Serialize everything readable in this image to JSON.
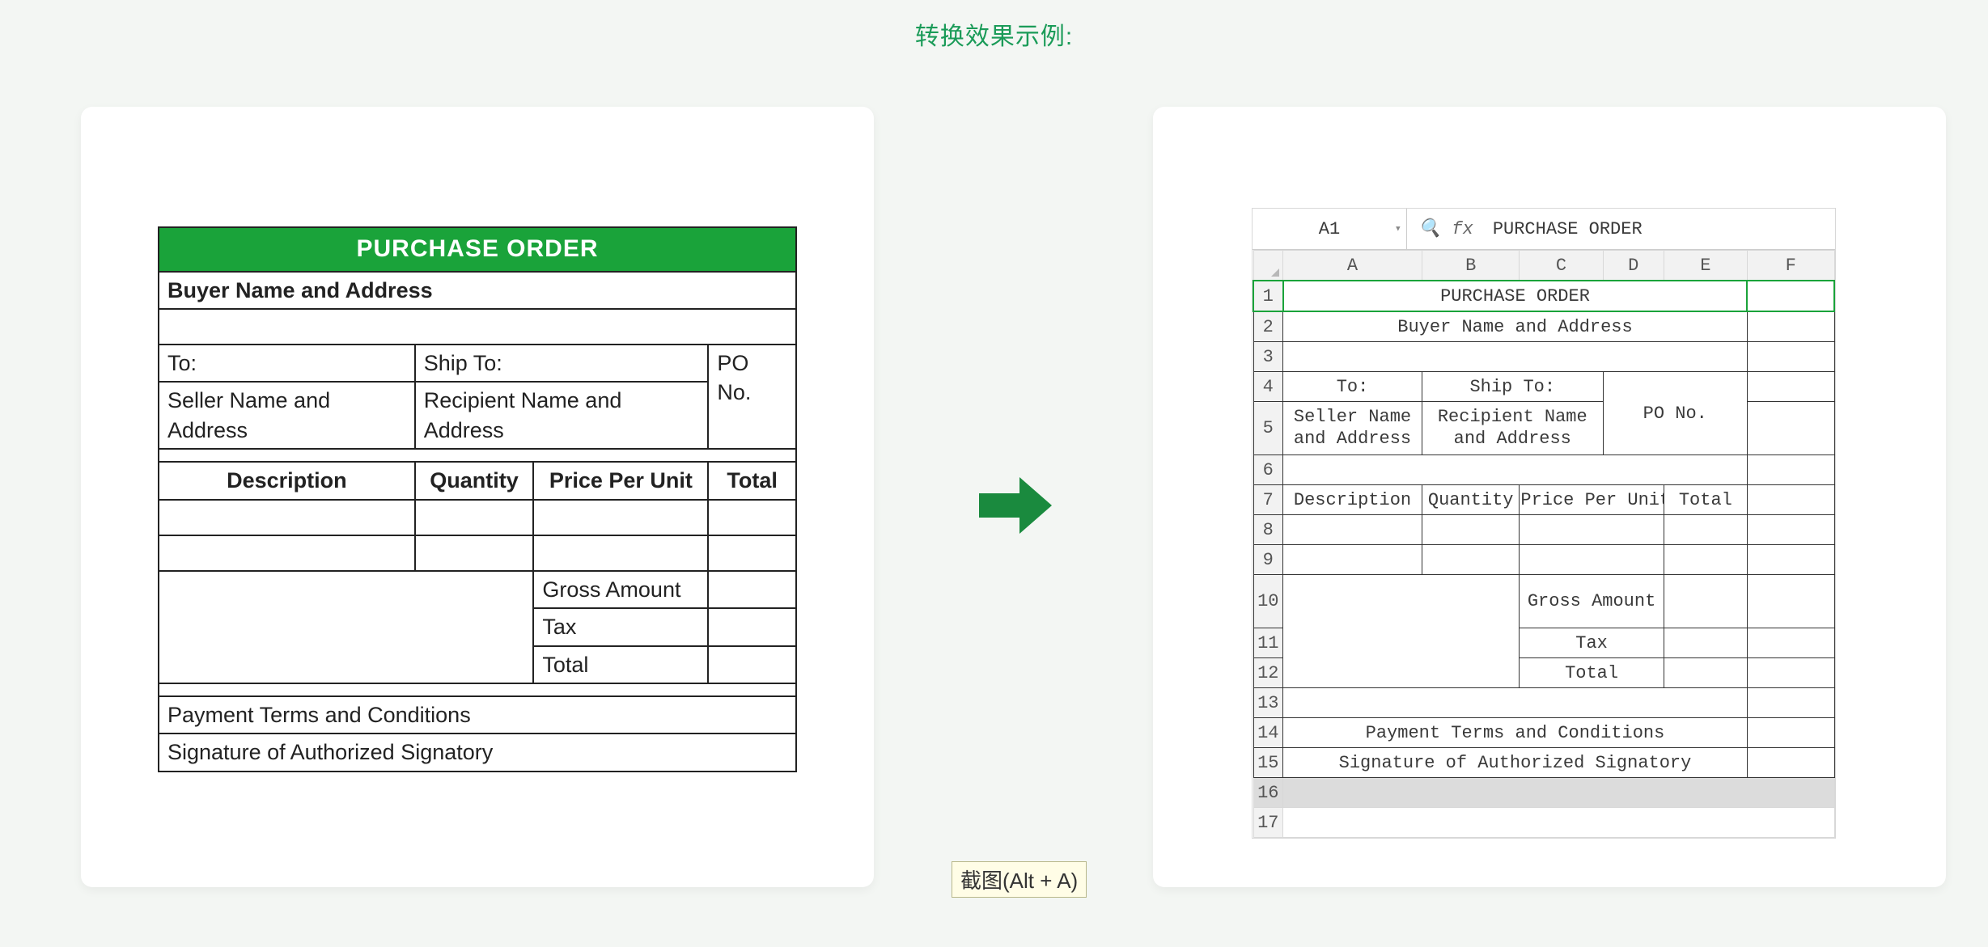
{
  "page_title": "转换效果示例:",
  "tooltip": "截图(Alt + A)",
  "left_doc": {
    "header": "PURCHASE ORDER",
    "buyer": "Buyer Name and Address",
    "to": "To:",
    "ship_to": "Ship To:",
    "seller": "Seller Name and Address",
    "recipient": "Recipient Name and Address",
    "po_no": "PO No.",
    "cols": {
      "description": "Description",
      "quantity": "Quantity",
      "ppu": "Price Per Unit",
      "total": "Total"
    },
    "gross": "Gross Amount",
    "tax": "Tax",
    "total": "Total",
    "payment": "Payment Terms and Conditions",
    "signature": "Signature of Authorized Signatory"
  },
  "sheet": {
    "name_box": "A1",
    "fx_label": "fx",
    "formula_value": "PURCHASE ORDER",
    "col_headers": [
      "A",
      "B",
      "C",
      "D",
      "E",
      "F"
    ],
    "rows": {
      "1": {
        "title": "PURCHASE ORDER"
      },
      "2": {
        "buyer": "Buyer Name and Address"
      },
      "4": {
        "to": "To:",
        "ship_to": "Ship To:"
      },
      "5": {
        "seller": "Seller Name and Address",
        "recipient": "Recipient Name and Address",
        "po_no": "PO No."
      },
      "7": {
        "description": "Description",
        "quantity": "Quantity",
        "ppu": "Price Per Unit",
        "total": "Total"
      },
      "10": {
        "gross": "Gross Amount"
      },
      "11": {
        "tax": "Tax"
      },
      "12": {
        "total": "Total"
      },
      "14": {
        "payment": "Payment Terms and Conditions"
      },
      "15": {
        "signature": "Signature of Authorized Signatory"
      }
    },
    "row_labels": [
      "1",
      "2",
      "3",
      "4",
      "5",
      "6",
      "7",
      "8",
      "9",
      "10",
      "11",
      "12",
      "13",
      "14",
      "15",
      "16",
      "17"
    ]
  }
}
